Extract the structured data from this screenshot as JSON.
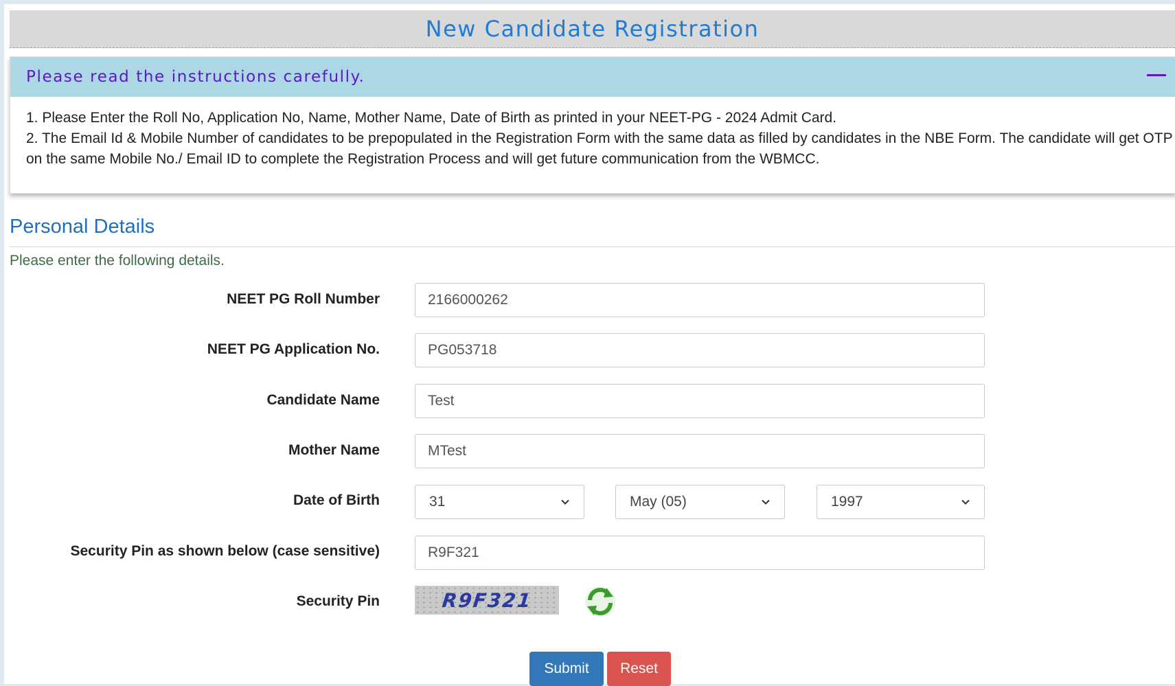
{
  "page_title": "New Candidate Registration",
  "instructions": {
    "title": "Please read the instructions carefully.",
    "line1": "1. Please Enter the Roll No, Application No, Name, Mother Name, Date of Birth as printed in your NEET-PG - 2024 Admit Card.",
    "line2": "2. The Email Id & Mobile Number of candidates to be prepopulated in the Registration Form with the same data as filled by candidates in the NBE Form. The candidate will get OTP on the same Mobile No./ Email ID to complete the Registration Process and will get future communication from the WBMCC."
  },
  "personal_details": {
    "title": "Personal Details",
    "subtitle": "Please enter the following details."
  },
  "fields": {
    "roll_label": "NEET PG Roll Number",
    "roll_value": "2166000262",
    "app_label": "NEET PG Application No.",
    "app_value": "PG053718",
    "name_label": "Candidate Name",
    "name_value": "Test",
    "mother_label": "Mother Name",
    "mother_value": "MTest",
    "dob_label": "Date of Birth",
    "dob_day": "31",
    "dob_month": "May (05)",
    "dob_year": "1997",
    "pin_input_label": "Security Pin as shown below (case sensitive)",
    "pin_input_value": "R9F321",
    "pin_label": "Security Pin",
    "captcha_text": "R9F321"
  },
  "buttons": {
    "submit": "Submit",
    "reset": "Reset"
  },
  "icons": {
    "collapse": "minus-icon",
    "refresh": "refresh-icon",
    "dropdown": "chevron-down-icon"
  },
  "colors": {
    "title": "#1e7bd6",
    "instr_header_bg": "#acd8e6",
    "instr_title": "#5c18c8",
    "section_title": "#1f6fc1",
    "submit_bg": "#3278b8",
    "reset_bg": "#d9534f"
  }
}
